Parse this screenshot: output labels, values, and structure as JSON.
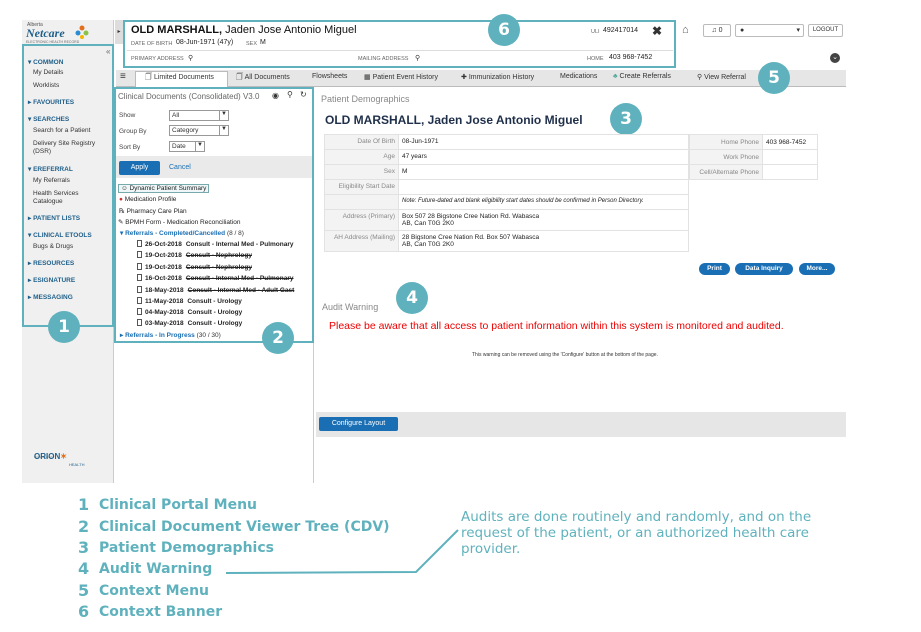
{
  "logo": {
    "line1": "Alberta",
    "name": "Netcare",
    "tagline": "ELECTRONIC HEALTH RECORD"
  },
  "menu": {
    "sections": [
      {
        "label": "▾ COMMON",
        "items": [
          "My Details",
          "Worklists"
        ]
      },
      {
        "label": "▸ FAVOURITES",
        "items": []
      },
      {
        "label": "▾ SEARCHES",
        "items": [
          "Search for a Patient",
          "Delivery Site Registry",
          "(DSR)"
        ]
      },
      {
        "label": "▾ EREFERRAL",
        "items": [
          "My Referrals",
          "Health Services",
          "Catalogue"
        ]
      },
      {
        "label": "▸ PATIENT LISTS",
        "items": []
      },
      {
        "label": "▾ CLINICAL ETOOLS",
        "items": [
          "Bugs & Drugs"
        ]
      },
      {
        "label": "▸ RESOURCES",
        "items": []
      },
      {
        "label": "▸ ESIGNATURE",
        "items": []
      },
      {
        "label": "▸ MESSAGING",
        "items": []
      }
    ],
    "powered": "POWERED BY",
    "orion": "ORION",
    "health": "HEALTH"
  },
  "banner": {
    "surname": "OLD MARSHALL,",
    "given": "Jaden Jose Antonio Miguel",
    "dob_label": "DATE OF BIRTH",
    "dob": "08-Jun-1971 (47y)",
    "sex_label": "SEX",
    "sex": "M",
    "uli_label": "ULI",
    "uli": "492417014",
    "primary_label": "PRIMARY ADDRESS",
    "mailing_label": "MAILING ADDRESS",
    "home_label": "HOME",
    "home": "403 968-7452"
  },
  "topbar": {
    "notif_count": "0",
    "logout": "LOGOUT"
  },
  "tabs": [
    "Limited Documents",
    "All Documents",
    "Flowsheets",
    "Patient Event History",
    "Immunization History",
    "Medications",
    "Create Referrals",
    "View Referral"
  ],
  "cdv": {
    "title": "Clinical Documents (Consolidated) V3.0",
    "show_label": "Show",
    "show_value": "All",
    "group_label": "Group By",
    "group_value": "Category",
    "sort_label": "Sort By",
    "sort_value": "Date",
    "apply": "Apply",
    "cancel": "Cancel",
    "tree": [
      "Dynamic Patient Summary",
      "Medication Profile",
      "Pharmacy Care Plan",
      "BPMH Form - Medication Reconciliation"
    ],
    "ref_completed": "Referrals - Completed/Cancelled",
    "ref_completed_count": "(8 / 8)",
    "docs": [
      {
        "date": "26-Oct-2018",
        "title": "Consult - Internal Med - Pulmonary",
        "struck": false
      },
      {
        "date": "19-Oct-2018",
        "title": "Consult - Nephrology",
        "struck": true
      },
      {
        "date": "19-Oct-2018",
        "title": "Consult - Nephrology",
        "struck": true
      },
      {
        "date": "16-Oct-2018",
        "title": "Consult - Internal Med - Pulmonary",
        "struck": true
      },
      {
        "date": "18-May-2018",
        "title": "Consult - Internal Med - Adult Gast",
        "struck": true
      },
      {
        "date": "11-May-2018",
        "title": "Consult - Urology",
        "struck": false
      },
      {
        "date": "04-May-2018",
        "title": "Consult - Urology",
        "struck": false
      },
      {
        "date": "03-May-2018",
        "title": "Consult - Urology",
        "struck": false
      }
    ],
    "ref_progress": "Referrals - In Progress",
    "ref_progress_count": "(30 / 30)"
  },
  "demographics": {
    "heading": "Patient Demographics",
    "name": "OLD MARSHALL, Jaden Jose Antonio Miguel",
    "rows": [
      {
        "label": "Date Of Birth",
        "value": "08-Jun-1971"
      },
      {
        "label": "Age",
        "value": "47 years"
      },
      {
        "label": "Sex",
        "value": "M"
      },
      {
        "label": "Eligibility Start Date",
        "value": ""
      },
      {
        "label": "",
        "value": "Note: Future-dated and blank eligibility start dates should be confirmed in Person Directory."
      },
      {
        "label": "Address (Primary)",
        "value": "Box 507 28 Bigstone Cree Nation Rd. Wabasca",
        "value2": "AB, Can T0G 2K0"
      },
      {
        "label": "AH Address (Mailing)",
        "value": "28 Bigstone Cree Nation Rd. Box 507 Wabasca",
        "value2": "AB, Can T0G 2K0"
      }
    ],
    "phones": [
      {
        "label": "Home Phone",
        "value": "403 968-7452"
      },
      {
        "label": "Work Phone",
        "value": ""
      },
      {
        "label": "Cell/Alternate Phone",
        "value": ""
      }
    ],
    "buttons": [
      "Print",
      "Data Inquiry",
      "More..."
    ]
  },
  "audit": {
    "title": "Audit Warning",
    "message": "Please be aware that all access to patient information within this system is monitored and audited.",
    "note": "This warning can be removed using the 'Configure' button at the bottom of the page."
  },
  "configure": "Configure Layout",
  "badges": [
    "1",
    "2",
    "3",
    "4",
    "5",
    "6"
  ],
  "legend": [
    {
      "num": "1",
      "label": "Clinical Portal Menu"
    },
    {
      "num": "2",
      "label": "Clinical Document Viewer Tree (CDV)"
    },
    {
      "num": "3",
      "label": "Patient Demographics"
    },
    {
      "num": "4",
      "label": "Audit Warning"
    },
    {
      "num": "5",
      "label": "Context Menu"
    },
    {
      "num": "6",
      "label": "Context Banner"
    }
  ],
  "callout": "Audits are done routinely and randomly, and on the request of the patient, or an authorized health care provider.",
  "colors": {
    "accent": "#5fb2bd",
    "link": "#1a6fb4",
    "alert": "#ee0000"
  }
}
